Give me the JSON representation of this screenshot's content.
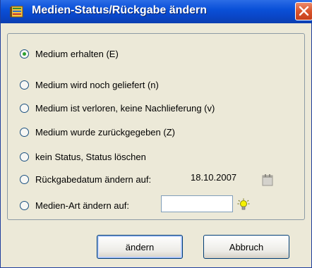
{
  "window": {
    "title": "Medien-Status/Rückgabe ändern"
  },
  "options": [
    {
      "label": "Medium erhalten (E)",
      "checked": true
    },
    {
      "label": "Medium wird noch geliefert (n)",
      "checked": false
    },
    {
      "label": "Medium ist verloren, keine Nachlieferung (v)",
      "checked": false
    },
    {
      "label": "Medium wurde zurückgegeben (Z)",
      "checked": false
    },
    {
      "label": "kein Status, Status löschen",
      "checked": false
    },
    {
      "label": "Rückgabedatum ändern auf:",
      "checked": false
    },
    {
      "label": "Medien-Art ändern auf:",
      "checked": false
    }
  ],
  "return_date": "18.10.2007",
  "media_type_field": {
    "value": ""
  },
  "buttons": {
    "change_label": "ändern",
    "cancel_label": "Abbruch"
  },
  "colors": {
    "title_bar": "#0a50d8",
    "close_button": "#d9542c",
    "dialog_background": "#ece9d8",
    "radio_selected_dot": "#2ca02c"
  },
  "icons": [
    "notebook-app-icon",
    "close-icon",
    "calendar-icon",
    "light-bulb-icon"
  ]
}
